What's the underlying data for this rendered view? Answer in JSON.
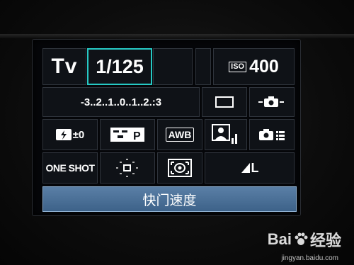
{
  "camera": {
    "mode": "Tv",
    "shutter_speed": "1/125",
    "iso_label": "ISO",
    "iso_value": "400",
    "exposure_scale": "-3..2..1..0..1..2.:3",
    "flash_comp": "±0",
    "awb": "AWB",
    "af_mode": "ONE SHOT",
    "quality": "L",
    "selected_label": "快门速度"
  },
  "watermark": {
    "brand": "Bai",
    "brand2": "经验",
    "url": "jingyan.baidu.com"
  },
  "colors": {
    "selection": "#26c9c4",
    "label_bar": "#4a6f96"
  }
}
